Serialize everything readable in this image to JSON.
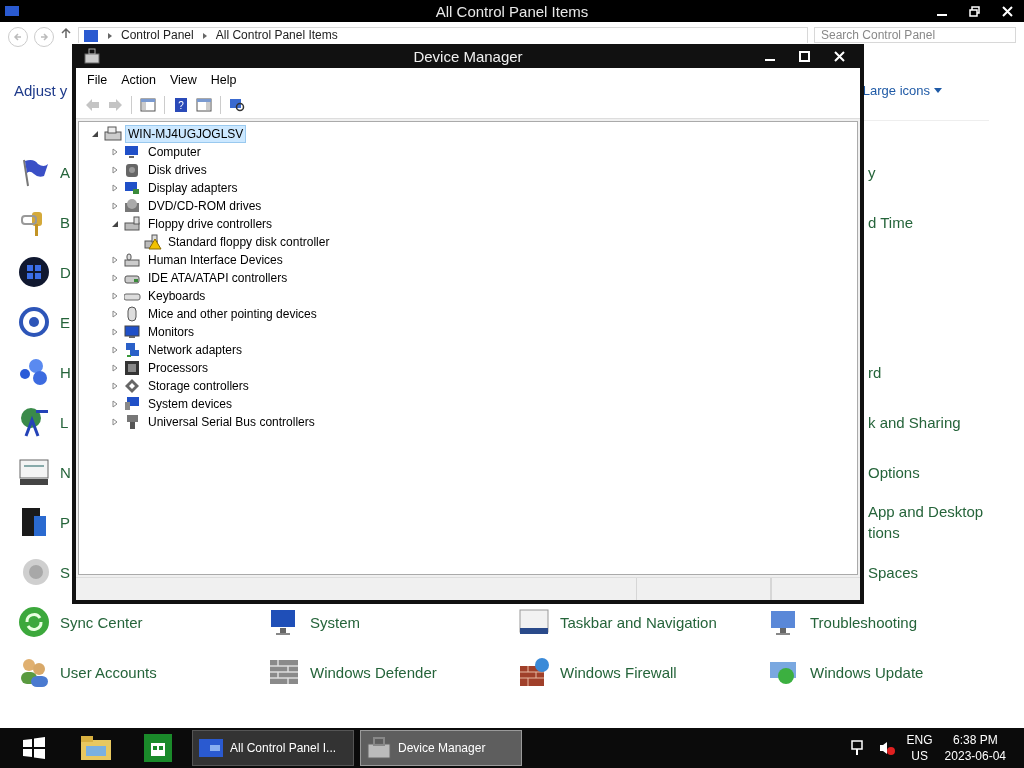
{
  "control_panel": {
    "title": "All Control Panel Items",
    "breadcrumb": [
      "Control Panel",
      "All Control Panel Items"
    ],
    "search": {
      "placeholder": "Search Control Panel"
    },
    "heading": "Adjust y",
    "view_mode": "Large icons",
    "covered_rows": [
      {
        "left": "A",
        "right": "y"
      },
      {
        "left": "B",
        "right": "d Time"
      },
      {
        "left": "D"
      },
      {
        "left": "E"
      },
      {
        "left": "H",
        "right": "rd"
      },
      {
        "left": "L",
        "right": "k and Sharing"
      },
      {
        "left": "N",
        "right": "Options"
      },
      {
        "left": "P",
        "right": "App and Desktop\ntions"
      },
      {
        "left": "S",
        "right": "Spaces"
      }
    ],
    "rows": [
      [
        "Sync Center",
        "System",
        "Taskbar and Navigation",
        "Troubleshooting"
      ],
      [
        "User Accounts",
        "Windows Defender",
        "Windows Firewall",
        "Windows Update"
      ]
    ]
  },
  "device_manager": {
    "title": "Device Manager",
    "menu": [
      "File",
      "Action",
      "View",
      "Help"
    ],
    "toolbar": [
      {
        "kind": "back",
        "disabled": true
      },
      {
        "kind": "forward",
        "disabled": true
      },
      {
        "kind": "separator"
      },
      {
        "kind": "console-tree",
        "disabled": false
      },
      {
        "kind": "separator"
      },
      {
        "kind": "help",
        "disabled": false,
        "glyph": "?"
      },
      {
        "kind": "action-pane",
        "disabled": false
      },
      {
        "kind": "separator"
      },
      {
        "kind": "scan",
        "disabled": false
      }
    ],
    "tree": {
      "label": "WIN-MJ4UGJOGLSV",
      "selected": true,
      "expanded": true,
      "children": [
        {
          "label": "Computer",
          "selected": false,
          "expanded": false
        },
        {
          "label": "Disk drives",
          "selected": false,
          "expanded": false
        },
        {
          "label": "Display adapters",
          "selected": false,
          "expanded": false
        },
        {
          "label": "DVD/CD-ROM drives",
          "selected": false,
          "expanded": false
        },
        {
          "label": "Floppy drive controllers",
          "selected": false,
          "expanded": true,
          "children": [
            {
              "label": "Standard floppy disk controller",
              "selected": false,
              "warning": true
            }
          ]
        },
        {
          "label": "Human Interface Devices",
          "selected": false,
          "expanded": false
        },
        {
          "label": "IDE ATA/ATAPI controllers",
          "selected": false,
          "expanded": false
        },
        {
          "label": "Keyboards",
          "selected": false,
          "expanded": false
        },
        {
          "label": "Mice and other pointing devices",
          "selected": false,
          "expanded": false
        },
        {
          "label": "Monitors",
          "selected": false,
          "expanded": false
        },
        {
          "label": "Network adapters",
          "selected": false,
          "expanded": false
        },
        {
          "label": "Processors",
          "selected": false,
          "expanded": false
        },
        {
          "label": "Storage controllers",
          "selected": false,
          "expanded": false
        },
        {
          "label": "System devices",
          "selected": false,
          "expanded": false
        },
        {
          "label": "Universal Serial Bus controllers",
          "selected": false,
          "expanded": false
        }
      ]
    }
  },
  "taskbar": {
    "tasks": [
      {
        "label": "All Control Panel I...",
        "selected": false
      },
      {
        "label": "Device Manager",
        "selected": true
      }
    ],
    "language": [
      "ENG",
      "US"
    ],
    "time": "6:38 PM",
    "date": "2023-06-04"
  }
}
